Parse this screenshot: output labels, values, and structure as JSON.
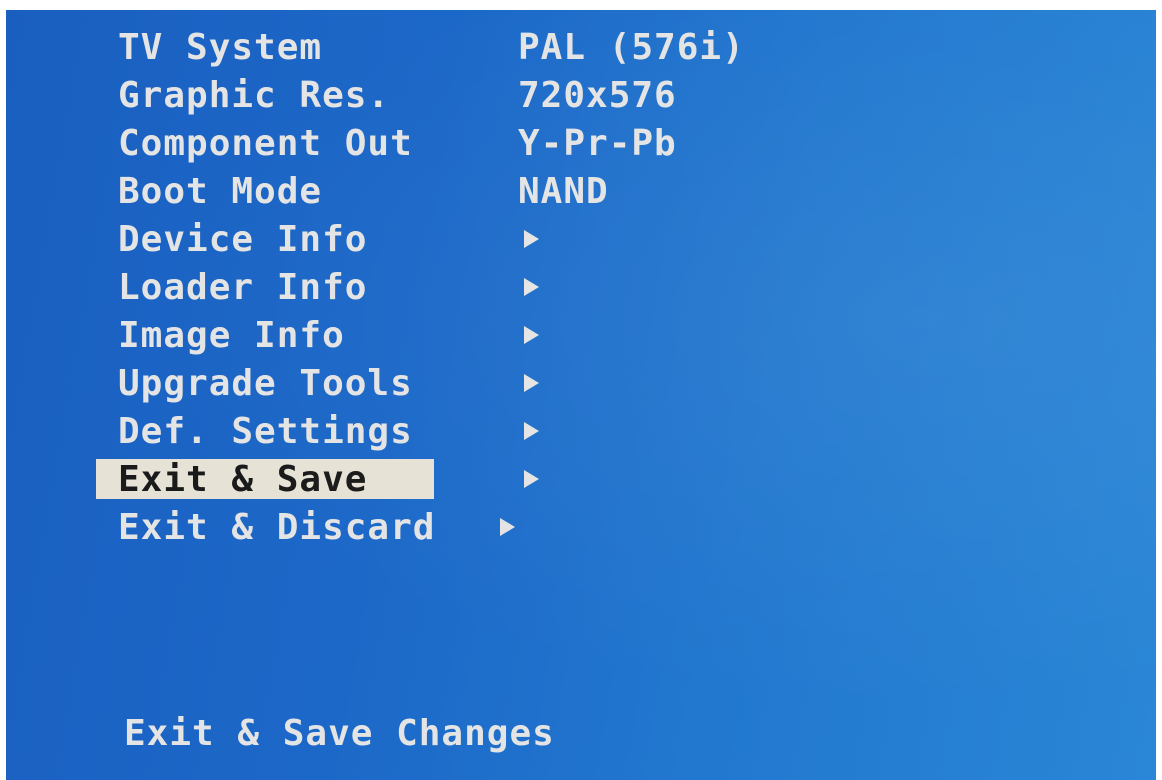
{
  "menu": {
    "items": [
      {
        "label": "TV System",
        "value": "PAL (576i)"
      },
      {
        "label": "Graphic Res.",
        "value": "720x576"
      },
      {
        "label": "Component Out",
        "value": "Y-Pr-Pb"
      },
      {
        "label": "Boot Mode",
        "value": "NAND"
      },
      {
        "label": "Device Info",
        "icon": "play-arrow-icon"
      },
      {
        "label": "Loader Info",
        "icon": "play-arrow-icon"
      },
      {
        "label": "Image Info",
        "icon": "play-arrow-icon"
      },
      {
        "label": "Upgrade Tools",
        "icon": "play-arrow-icon"
      },
      {
        "label": "Def. Settings",
        "icon": "play-arrow-icon"
      },
      {
        "label": "Exit & Save",
        "icon": "play-arrow-icon",
        "selected": true
      },
      {
        "label": "Exit & Discard",
        "icon": "play-arrow-icon"
      }
    ]
  },
  "footer": {
    "help_text": "Exit & Save Changes"
  },
  "colors": {
    "background": "#1c68c8",
    "text": "#e4e4e4",
    "highlight": "#e6e2d6"
  }
}
